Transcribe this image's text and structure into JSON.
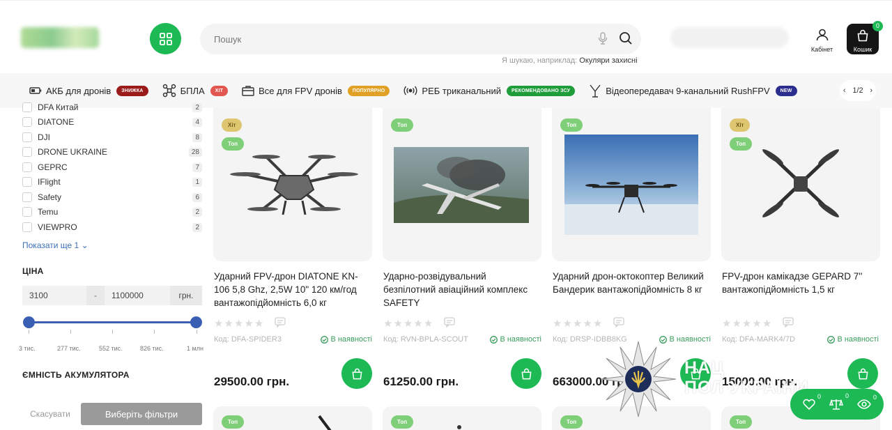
{
  "header": {
    "search_placeholder": "Пошук",
    "search_hint_prefix": "Я шукаю, наприклад:",
    "search_hint_example": "Окуляри захисні",
    "cabinet_label": "Кабінет",
    "cart_label": "Кошик",
    "cart_count": "0"
  },
  "categories": [
    {
      "name": "АКБ для дронів",
      "badge": "знижка",
      "badge_color": "#9b1b1b",
      "icon": "battery-icon"
    },
    {
      "name": "БПЛА",
      "badge": "хіт",
      "badge_color": "#e1574f",
      "icon": "drone-icon"
    },
    {
      "name": "Все для FPV дронів",
      "badge": "популярно",
      "badge_color": "#e0a126",
      "icon": "box-icon"
    },
    {
      "name": "РЕБ триканальний",
      "badge": "рекомендовано ЗСУ",
      "badge_color": "#1f9d3b",
      "icon": "signal-icon"
    },
    {
      "name": "Відеопередавач 9-канальний RushFPV",
      "badge": "new",
      "badge_color": "#2b2d8f",
      "icon": "antenna-icon"
    }
  ],
  "category_pager": "1/2",
  "filters": {
    "brands": [
      {
        "name": "DFA Китай",
        "count": "2"
      },
      {
        "name": "DIATONE",
        "count": "4"
      },
      {
        "name": "DJI",
        "count": "8"
      },
      {
        "name": "DRONE UKRAINE",
        "count": "28"
      },
      {
        "name": "GEPRC",
        "count": "7"
      },
      {
        "name": "IFlight",
        "count": "1"
      },
      {
        "name": "Safety",
        "count": "6"
      },
      {
        "name": "Temu",
        "count": "2"
      },
      {
        "name": "VIEWPRO",
        "count": "2"
      }
    ],
    "show_more": "Показати ще 1",
    "price_title": "ЦІНА",
    "price_min": "3100",
    "price_max": "1100000",
    "price_dash": "-",
    "currency": "грн.",
    "ticks": [
      "3 тис.",
      "277 тис.",
      "552 тис.",
      "826 тис.",
      "1 млн"
    ],
    "battery_title": "ЄМНІСТЬ АКУМУЛЯТОРА",
    "cancel_label": "Скасувати",
    "apply_label": "Виберіть фільтри"
  },
  "products": [
    {
      "tags": [
        "Хіт",
        "Топ"
      ],
      "title": "Ударний FPV-дрон DIATONE KN-106 5,8 Ghz, 2,5W 10\" 120 км/год вантажопідйомність 6,0 кг",
      "sku": "Код: DFA-SPIDER3",
      "stock": "В наявності",
      "price": "29500.00 грн."
    },
    {
      "tags": [
        "Топ"
      ],
      "title": "Ударно-розвідувальний безпілотний авіаційний комплекс SAFETY",
      "sku": "Код: RVN-BPLA-SCOUT",
      "stock": "В наявності",
      "price": "61250.00 грн."
    },
    {
      "tags": [
        "Топ"
      ],
      "title": "Ударний дрон-октокоптер Великий Бандерик вантажопідйомність 8 кг",
      "sku": "Код: DRSP-IDBB8KG",
      "stock": "В наявності",
      "price": "663000.00 грн."
    },
    {
      "tags": [
        "Хіт",
        "Топ"
      ],
      "title": "FPV-дрон камікадзе GEPARD 7'' вантажопідйомність 1,5 кг",
      "sku": "Код: DFA-MARK4/7D",
      "stock": "В наявності",
      "price": "15000.00 грн."
    }
  ],
  "row2_tags": [
    "Топ",
    "Топ",
    "Топ",
    "Топ"
  ],
  "watermark": {
    "line1": "НАЦ",
    "line2": "ПОЛ   УКРАЇНИ"
  },
  "floatbar": {
    "favorites": "0",
    "compare": "0",
    "viewed": "0"
  },
  "colors": {
    "accent": "#1db955",
    "slider": "#3b5fb3",
    "stock": "#3a9d5d"
  }
}
